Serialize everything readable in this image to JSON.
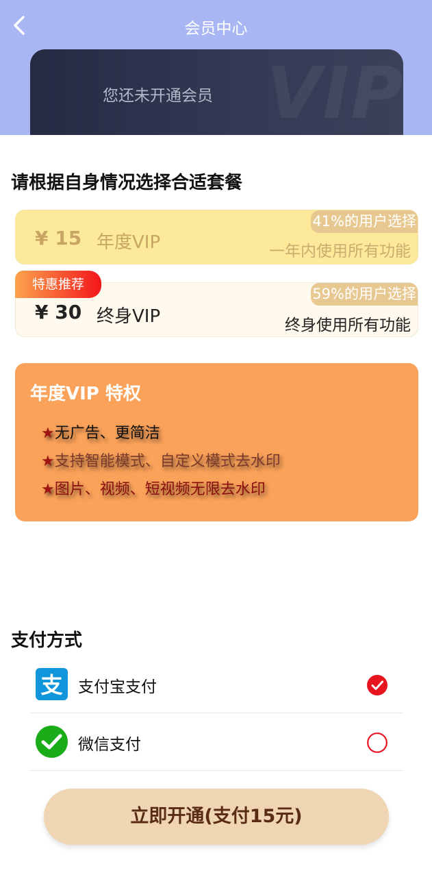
{
  "header": {
    "title": "会员中心"
  },
  "vip_card": {
    "status": "您还未开通会员",
    "watermark": "VIP"
  },
  "plans_section": {
    "title": "请根据自身情况选择合适套餐"
  },
  "plans": [
    {
      "price": "¥ 15",
      "name": "年度VIP",
      "share": "41%的用户选择",
      "desc": "一年内使用所有功能",
      "selected": true
    },
    {
      "price": "¥ 30",
      "name": "终身VIP",
      "share": "59%的用户选择",
      "desc": "终身使用所有功能",
      "badge": "特惠推荐"
    }
  ],
  "privileges": {
    "title": "年度VIP 特权",
    "items": [
      {
        "star": "★",
        "text": "无广告、更简洁",
        "color": "#111111"
      },
      {
        "star": "★",
        "text": "支持智能模式、自定义模式去水印",
        "color": "#7a3a2c"
      },
      {
        "star": "★",
        "text": "图片、视频、短视频无限去水印",
        "color": "#8a1010"
      }
    ]
  },
  "payment_section": {
    "title": "支付方式"
  },
  "payment_methods": [
    {
      "label": "支付宝支付",
      "icon": "alipay-icon",
      "selected": true
    },
    {
      "label": "微信支付",
      "icon": "wechat-icon",
      "selected": false
    }
  ],
  "cta": {
    "label": "立即开通(支付15元)"
  },
  "colors": {
    "accent_red": "#e6151f",
    "header_bg": "#a8b7f3",
    "privilege_bg": "#fba25a",
    "cta_bg": "#f0d5b3"
  }
}
